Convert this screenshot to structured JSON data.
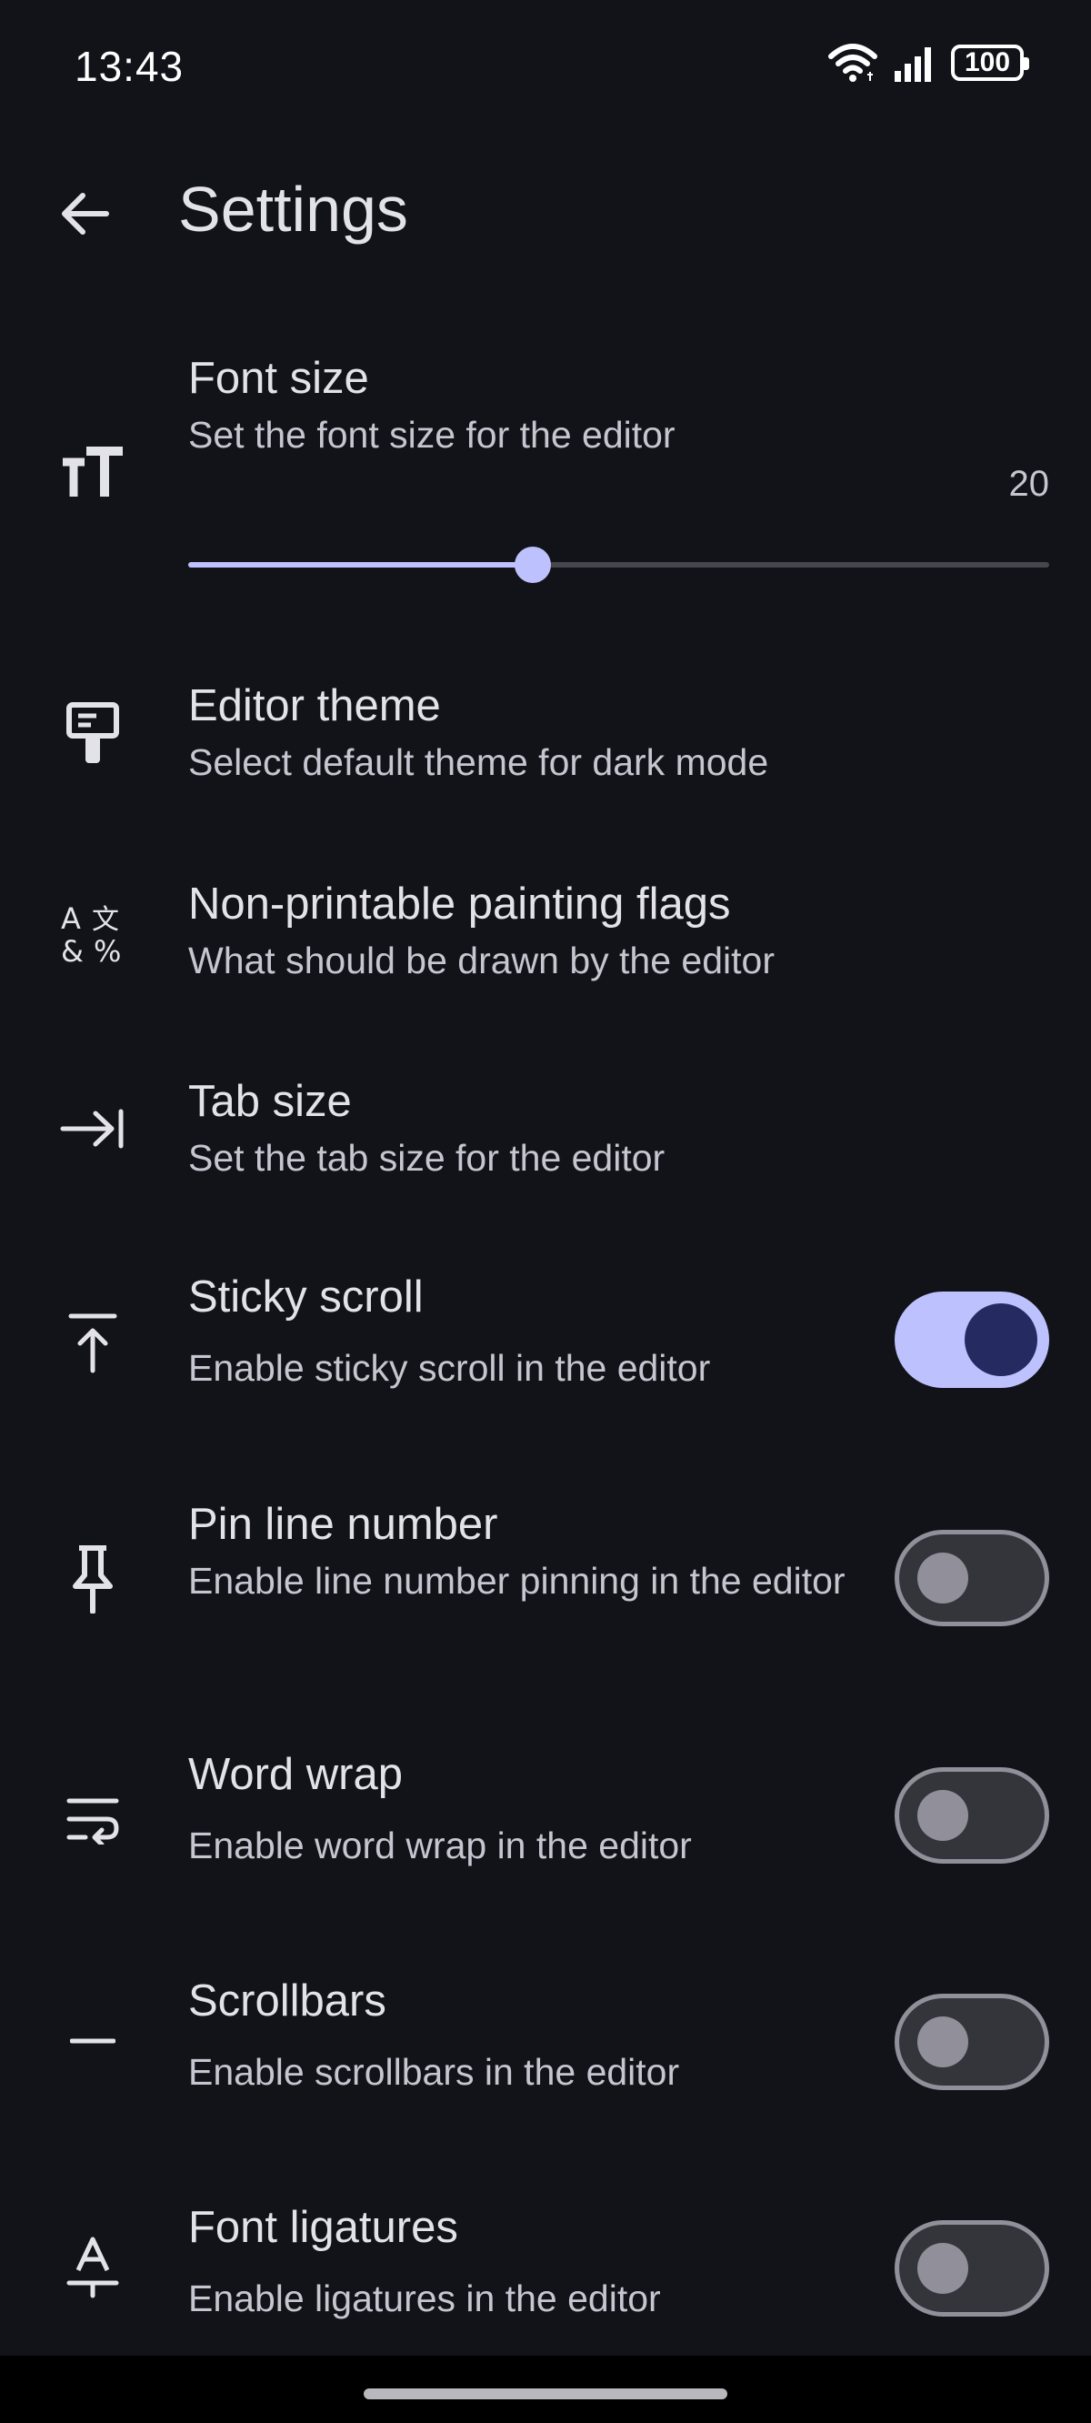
{
  "status_bar": {
    "time": "13:43",
    "battery_level": "100",
    "icons": [
      "wifi-icon",
      "cellular-signal-icon",
      "battery-icon"
    ]
  },
  "app_bar": {
    "title": "Settings",
    "back_icon": "arrow-back-icon"
  },
  "colors": {
    "background": "#121318",
    "accent": "#bdc2ff",
    "switch_on_knob": "#252b61",
    "switch_off_track": "#34343b",
    "switch_off_outline": "#91909a",
    "text_primary": "#e3e2e9",
    "text_secondary": "#c6c5d0"
  },
  "settings": {
    "font_size": {
      "icon": "text-size-icon",
      "title": "Font size",
      "subtitle": "Set the font size for the editor",
      "value": "20",
      "slider_fraction": 0.4
    },
    "editor_theme": {
      "icon": "paint-roller-icon",
      "title": "Editor theme",
      "subtitle": "Select default theme for dark mode"
    },
    "non_printable": {
      "icon": "special-characters-icon",
      "title": "Non-printable painting flags",
      "subtitle": "What should be drawn by the editor"
    },
    "tab_size": {
      "icon": "keyboard-tab-icon",
      "title": "Tab size",
      "subtitle": "Set the tab size for the editor"
    },
    "sticky_scroll": {
      "icon": "vertical-align-top-icon",
      "title": "Sticky scroll",
      "subtitle": "Enable sticky scroll in the editor",
      "enabled": true
    },
    "pin_line_number": {
      "icon": "push-pin-icon",
      "title": "Pin line number",
      "subtitle": "Enable line number pinning in the editor",
      "enabled": false
    },
    "word_wrap": {
      "icon": "wrap-text-icon",
      "title": "Word wrap",
      "subtitle": "Enable word wrap in the editor",
      "enabled": false
    },
    "scrollbars": {
      "icon": "horizontal-rule-icon",
      "title": "Scrollbars",
      "subtitle": "Enable scrollbars in the editor",
      "enabled": false
    },
    "font_ligatures": {
      "icon": "text-ligature-icon",
      "title": "Font ligatures",
      "subtitle": "Enable ligatures in the editor",
      "enabled": false
    }
  }
}
